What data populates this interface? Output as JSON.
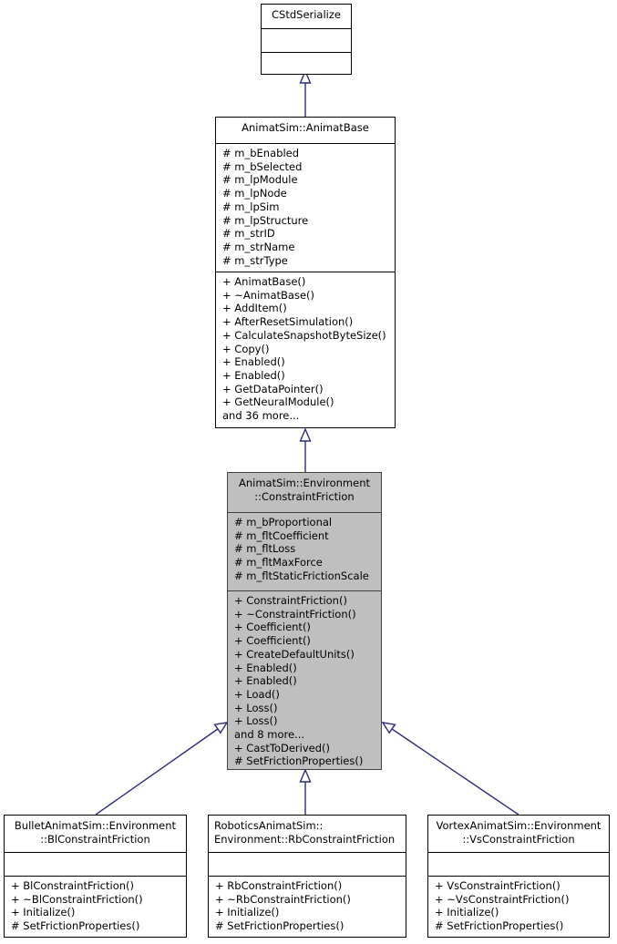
{
  "diagram": {
    "type": "uml-class-inheritance",
    "title": "Inheritance diagram for AnimatSim::Environment::ConstraintFriction",
    "highlight_color": "#bfbfbf",
    "edge_color": "#2c2c7c",
    "background_color": "#ffffff"
  },
  "classes": [
    {
      "id": "cstdserialize",
      "name": "CStdSerialize",
      "highlighted": false,
      "attributes": [],
      "methods": []
    },
    {
      "id": "animatbase",
      "name": "AnimatSim::AnimatBase",
      "highlighted": false,
      "attributes": [
        "# m_bEnabled",
        "# m_bSelected",
        "# m_lpModule",
        "# m_lpNode",
        "# m_lpSim",
        "# m_lpStructure",
        "# m_strID",
        "# m_strName",
        "# m_strType"
      ],
      "methods": [
        "+ AnimatBase()",
        "+ ~AnimatBase()",
        "+ AddItem()",
        "+ AfterResetSimulation()",
        "+ CalculateSnapshotByteSize()",
        "+ Copy()",
        "+ Enabled()",
        "+ Enabled()",
        "+ GetDataPointer()",
        "+ GetNeuralModule()",
        "and 36 more..."
      ]
    },
    {
      "id": "constraintfriction",
      "name": "AnimatSim::Environment\n::ConstraintFriction",
      "highlighted": true,
      "attributes": [
        "# m_bProportional",
        "# m_fltCoefficient",
        "# m_fltLoss",
        "# m_fltMaxForce",
        "# m_fltStaticFrictionScale"
      ],
      "methods": [
        "+ ConstraintFriction()",
        "+ ~ConstraintFriction()",
        "+ Coefficient()",
        "+ Coefficient()",
        "+ CreateDefaultUnits()",
        "+ Enabled()",
        "+ Enabled()",
        "+ Load()",
        "+ Loss()",
        "+ Loss()",
        "and 8 more...",
        "+ CastToDerived()",
        "# SetFrictionProperties()"
      ]
    },
    {
      "id": "blconstraintfriction",
      "name": "BulletAnimatSim::Environment\n::BlConstraintFriction",
      "highlighted": false,
      "title_align": "center",
      "attributes": [],
      "methods": [
        "+ BlConstraintFriction()",
        "+ ~BlConstraintFriction()",
        "+ Initialize()",
        "# SetFrictionProperties()"
      ]
    },
    {
      "id": "rbconstraintfriction",
      "name": "RoboticsAnimatSim::\nEnvironment::RbConstraintFriction",
      "highlighted": false,
      "title_align": "left",
      "attributes": [],
      "methods": [
        "+ RbConstraintFriction()",
        "+ ~RbConstraintFriction()",
        "+ Initialize()",
        "# SetFrictionProperties()"
      ]
    },
    {
      "id": "vsconstraintfriction",
      "name": "VortexAnimatSim::Environment\n::VsConstraintFriction",
      "highlighted": false,
      "title_align": "center",
      "attributes": [],
      "methods": [
        "+ VsConstraintFriction()",
        "+ ~VsConstraintFriction()",
        "+ Initialize()",
        "# SetFrictionProperties()"
      ]
    }
  ],
  "edges": [
    {
      "from": "animatbase",
      "to": "cstdserialize",
      "kind": "generalization"
    },
    {
      "from": "constraintfriction",
      "to": "animatbase",
      "kind": "generalization"
    },
    {
      "from": "blconstraintfriction",
      "to": "constraintfriction",
      "kind": "generalization"
    },
    {
      "from": "rbconstraintfriction",
      "to": "constraintfriction",
      "kind": "generalization"
    },
    {
      "from": "vsconstraintfriction",
      "to": "constraintfriction",
      "kind": "generalization"
    }
  ]
}
